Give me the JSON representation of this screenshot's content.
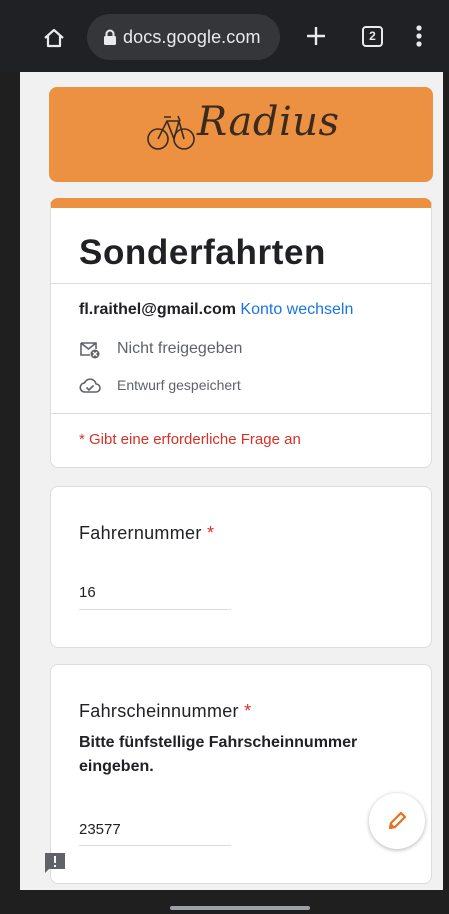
{
  "browser": {
    "url": "docs.google.com",
    "tab_count": "2"
  },
  "banner": {
    "brand": "Radius"
  },
  "form": {
    "title": "Sonderfahrten",
    "account_email": "fl.raithel@gmail.com",
    "switch_account": "Konto wechseln",
    "share_status": "Nicht freigegeben",
    "save_status": "Entwurf gespeichert",
    "required_note": "* Gibt eine erforderliche Frage an"
  },
  "questions": [
    {
      "title": "Fahrernummer",
      "required_marker": "*",
      "answer": "16"
    },
    {
      "title": "Fahrscheinnummer",
      "required_marker": "*",
      "description": "Bitte fünfstellige Fahrscheinnummer eingeben.",
      "answer": "23577"
    }
  ],
  "icons": {
    "home": "home-icon",
    "lock": "lock-icon",
    "new_tab": "plus-icon",
    "menu": "more-vert-icon",
    "logo": "bicycle-icon",
    "share": "unshared-icon",
    "save": "cloud-done-icon",
    "edit": "pencil-icon",
    "feedback": "feedback-icon"
  },
  "colors": {
    "accent": "#ec9142",
    "link": "#1a73e8",
    "required": "#d93025",
    "toolbar": "#202124"
  }
}
